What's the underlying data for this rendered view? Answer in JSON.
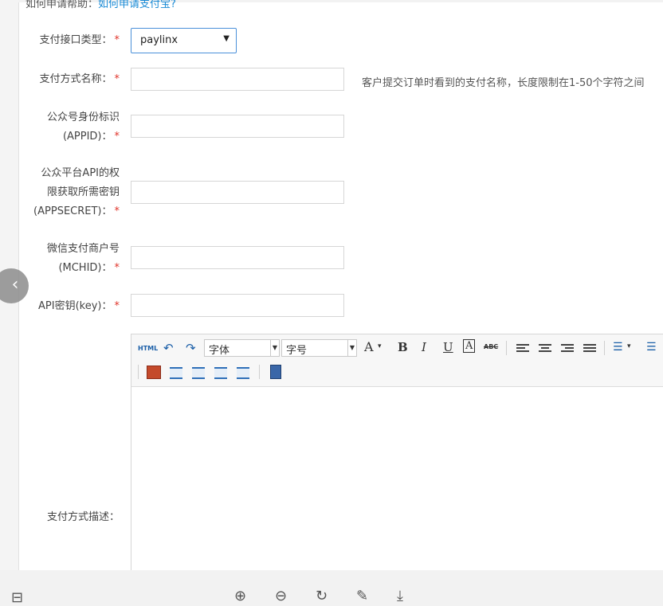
{
  "help": {
    "prefix": "如何申请帮助：",
    "link": "如何申请支付宝?"
  },
  "form": {
    "type_label": "支付接口类型：",
    "type_value": "paylinx",
    "name_label": "支付方式名称：",
    "name_hint": "客户提交订单时看到的支付名称，长度限制在1-50个字符之间",
    "appid_label_1": "公众号身份标识",
    "appid_label_2": "(APPID)：",
    "secret_label_1": "公众平台API的权",
    "secret_label_2": "限获取所需密钥",
    "secret_label_3": "(APPSECRET)：",
    "mchid_label_1": "微信支付商户号",
    "mchid_label_2": "(MCHID)：",
    "key_label": "API密钥(key)：",
    "desc_label": "支付方式描述：",
    "required_mark": "*"
  },
  "editor": {
    "html_btn": "HTML",
    "font_family": "字体",
    "font_size": "字号",
    "font_color": "A",
    "bold": "B",
    "italic": "I",
    "underline": "U",
    "border": "A",
    "strike": "ABC"
  },
  "icons": {
    "pager": "chevron-left-icon",
    "layout": "layout-icon",
    "zoom_in": "zoom-in-icon",
    "zoom_out": "zoom-out-icon",
    "rotate": "rotate-icon",
    "edit": "pencil-icon",
    "download": "download-icon"
  }
}
